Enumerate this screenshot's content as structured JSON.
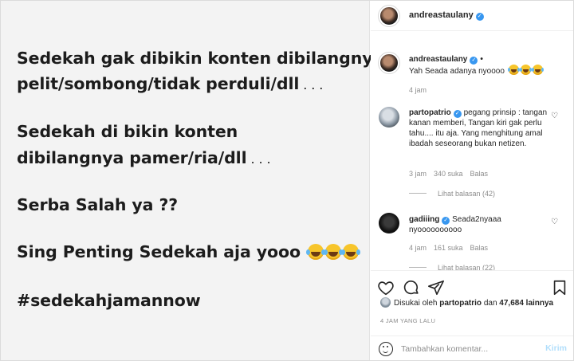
{
  "post": {
    "lines": [
      {
        "text": "Sedekah gak dibikin konten dibilangnya",
        "ell": "",
        "emoji": 0
      },
      {
        "text": "pelit/sombong/tidak perduli/dll",
        "ell": " . . .",
        "emoji": 0
      },
      {
        "text": "Sedekah di bikin konten",
        "ell": "",
        "emoji": 0
      },
      {
        "text": "dibilangnya pamer/ria/dll",
        "ell": " . . .",
        "emoji": 0
      },
      {
        "text": "Serba Salah ya ??",
        "ell": "",
        "emoji": 0
      },
      {
        "text": "Sing Penting Sedekah aja yooo",
        "ell": "",
        "emoji": 3
      },
      {
        "text": "#sedekahjamannow",
        "ell": "",
        "emoji": 0
      }
    ]
  },
  "header": {
    "username": "andreastaulany",
    "verified": true
  },
  "caption": {
    "username": "andreastaulany",
    "separator": "•",
    "text": "Yah Seada adanya nyoooo",
    "emoji_count": 3,
    "time": "4 jam"
  },
  "comments": [
    {
      "username": "partopatrio",
      "text": "pegang prinsip : tangan kanan memberi, Tangan kiri gak perlu tahu.... itu aja. Yang menghitung amal ibadah seseorang bukan netizen.",
      "time": "3 jam",
      "likes": "340 suka",
      "reply": "Balas",
      "view_replies": "Lihat balasan (42)"
    },
    {
      "username": "gadiiing",
      "text": "Seada2nyaaa nyoooooooooo",
      "time": "4 jam",
      "likes": "161 suka",
      "reply": "Balas",
      "view_replies": "Lihat balasan (22)"
    }
  ],
  "likes": {
    "prefix": "Disukai oleh",
    "user": "partopatrio",
    "joiner": "dan",
    "others": "47,684 lainnya"
  },
  "time_ago": "4 JAM YANG LALU",
  "composer": {
    "placeholder": "Tambahkan komentar...",
    "post_label": "Kirim"
  },
  "icons": {
    "like": "heart-icon",
    "comment": "comment-icon",
    "share": "share-icon",
    "save": "bookmark-icon",
    "emoji": "emoji-icon"
  },
  "colors": {
    "verified": "#3897f0",
    "post_button": "#b2dffc",
    "muted": "#8e8e8e"
  }
}
